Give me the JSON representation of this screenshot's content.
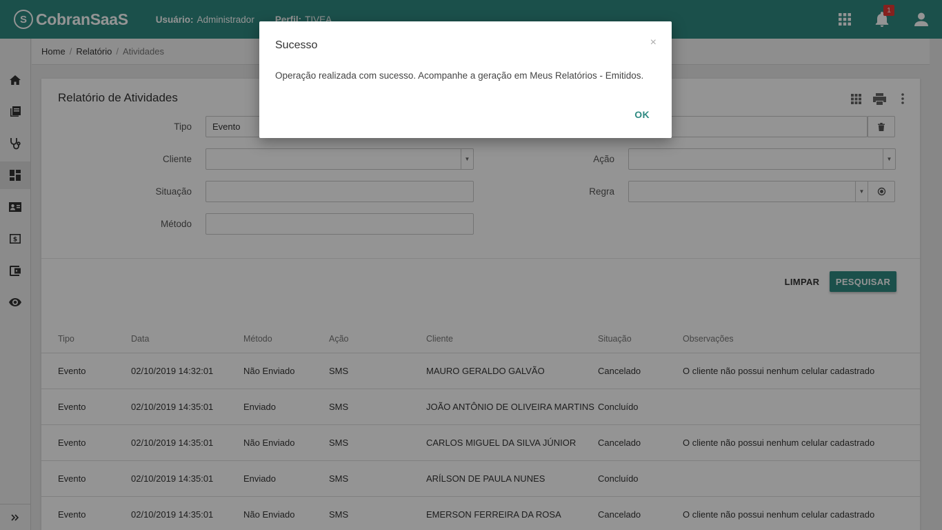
{
  "header": {
    "logo_mark": "S",
    "logo_text": "CobranSaaS",
    "user_label": "Usuário:",
    "user_value": "Administrador",
    "profile_label": "Perfil:",
    "profile_value": "TIVEA",
    "notification_count": "1",
    "accent_color": "#2f8a82"
  },
  "sidebar": {
    "items": [
      "home-icon",
      "book-icon",
      "stethoscope-icon",
      "dashboard-icon",
      "contact-card-icon",
      "money-icon",
      "wallet-icon",
      "eye-icon"
    ],
    "active_index": 3,
    "expand_icon": "double-chevron-right-icon"
  },
  "breadcrumb": {
    "items": [
      "Home",
      "Relatório",
      "Atividades"
    ]
  },
  "report": {
    "title": "Relatório de Atividades",
    "filters": {
      "tipo_label": "Tipo",
      "tipo_value": "Evento",
      "cliente_label": "Cliente",
      "situacao_label": "Situação",
      "metodo_label": "Método",
      "acao_label": "Ação",
      "regra_label": "Regra"
    },
    "clear_button": "LIMPAR",
    "search_button": "PESQUISAR"
  },
  "table": {
    "columns": [
      "Tipo",
      "Data",
      "Método",
      "Ação",
      "Cliente",
      "Situação",
      "Observações"
    ],
    "rows": [
      [
        "Evento",
        "02/10/2019 14:32:01",
        "Não Enviado",
        "SMS",
        "MAURO GERALDO GALVÃO",
        "Cancelado",
        "O cliente não possui nenhum celular cadastrado"
      ],
      [
        "Evento",
        "02/10/2019 14:35:01",
        "Enviado",
        "SMS",
        "JOÃO ANTÔNIO DE OLIVEIRA MARTINS",
        "Concluído",
        ""
      ],
      [
        "Evento",
        "02/10/2019 14:35:01",
        "Não Enviado",
        "SMS",
        "CARLOS MIGUEL DA SILVA JÚNIOR",
        "Cancelado",
        "O cliente não possui nenhum celular cadastrado"
      ],
      [
        "Evento",
        "02/10/2019 14:35:01",
        "Enviado",
        "SMS",
        "ARÍLSON DE PAULA NUNES",
        "Concluído",
        ""
      ],
      [
        "Evento",
        "02/10/2019 14:35:01",
        "Não Enviado",
        "SMS",
        "EMERSON FERREIRA DA ROSA",
        "Cancelado",
        "O cliente não possui nenhum celular cadastrado"
      ]
    ]
  },
  "modal": {
    "title": "Sucesso",
    "close": "×",
    "message": "Operação realizada com sucesso. Acompanhe a geração em Meus Relatórios - Emitidos.",
    "ok_button": "OK"
  }
}
